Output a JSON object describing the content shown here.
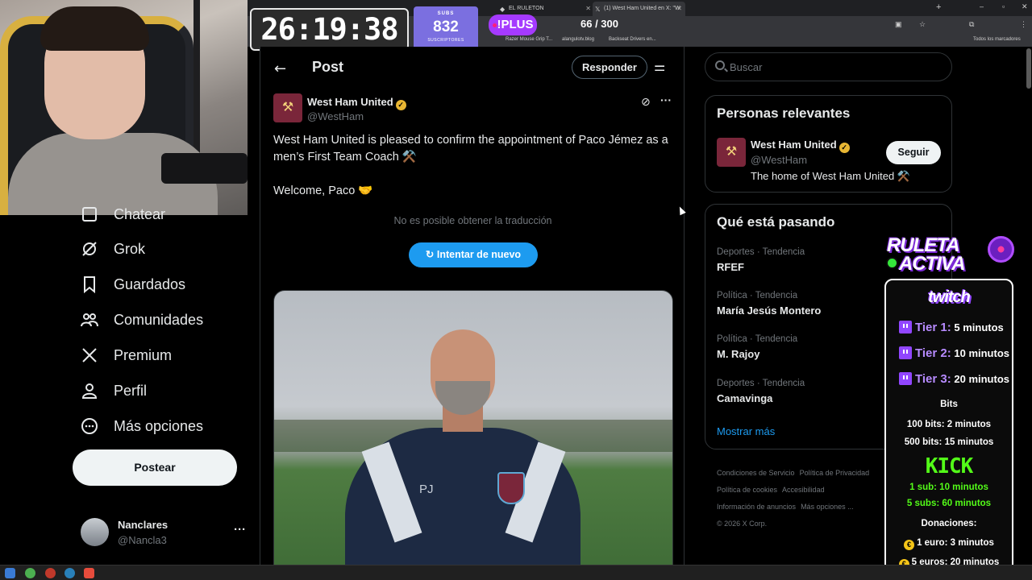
{
  "browser": {
    "tabs": [
      {
        "label": "EL RULETON",
        "active": false
      },
      {
        "label": "(1) West Ham United en X: \"W",
        "active": true
      }
    ],
    "bookmarks": [
      "Razer Mouse Grip T...",
      "alangulotv.blog",
      "Backseat Drivers en...",
      "Todos los marcadores"
    ]
  },
  "stream": {
    "timer": "26:19:38",
    "subs_label": "SUBS",
    "subs_count": "832",
    "subs_footer": "SUSCRIPTORES",
    "plus_label": "!PLUS",
    "counter": "66 / 300"
  },
  "leftnav": {
    "items": [
      {
        "label": "Chatear",
        "icon": "chat-icon"
      },
      {
        "label": "Grok",
        "icon": "grok-icon"
      },
      {
        "label": "Guardados",
        "icon": "bookmark-icon"
      },
      {
        "label": "Comunidades",
        "icon": "communities-icon"
      },
      {
        "label": "Premium",
        "icon": "x-logo-icon"
      },
      {
        "label": "Perfil",
        "icon": "profile-icon"
      },
      {
        "label": "Más opciones",
        "icon": "more-options-icon"
      }
    ],
    "post_button": "Postear",
    "user": {
      "name": "Nanclares",
      "handle": "@Nancla3"
    }
  },
  "main": {
    "title": "Post",
    "reply_button": "Responder",
    "author": {
      "name": "West Ham United",
      "handle": "@WestHam"
    },
    "text_line1": "West Ham United is pleased to confirm the appointment of Paco Jémez as a men’s First Team Coach ⚒️",
    "text_line2": "Welcome, Paco 🤝",
    "no_translation": "No es posible obtener la traducción",
    "retry_button": "Intentar de nuevo",
    "photo_initials": "PJ"
  },
  "right": {
    "search_placeholder": "Buscar",
    "relevant_title": "Personas relevantes",
    "relevant": {
      "name": "West Ham United",
      "handle": "@WestHam",
      "bio": "The home of West Ham United ⚒️",
      "follow": "Seguir"
    },
    "trends_title": "Qué está pasando",
    "trends": [
      {
        "category": "Deportes · Tendencia",
        "name": "RFEF"
      },
      {
        "category": "Política · Tendencia",
        "name": "María Jesús Montero"
      },
      {
        "category": "Política · Tendencia",
        "name": "M. Rajoy"
      },
      {
        "category": "Deportes · Tendencia",
        "name": "Camavinga"
      }
    ],
    "show_more": "Mostrar más",
    "footer": [
      "Condiciones de Servicio",
      "Política de Privacidad",
      "Política de cookies",
      "Accesibilidad",
      "Información de anuncios",
      "Más opciones ...",
      "© 2026 X Corp."
    ]
  },
  "ruleta": {
    "title1": "RULETA",
    "title2": "ACTIVA",
    "twitch": "twitch",
    "tiers": [
      {
        "key": "Tier 1:",
        "value": "5 minutos"
      },
      {
        "key": "Tier 2:",
        "value": "10 minutos"
      },
      {
        "key": "Tier 3:",
        "value": "20 minutos"
      }
    ],
    "bits_title": "Bits",
    "bits": [
      "100 bits: 2 minutos",
      "500 bits: 15 minutos"
    ],
    "kick": "KICK",
    "kick_lines": [
      "1 sub: 10 minutos",
      "5 subs: 60 minutos"
    ],
    "donations_title": "Donaciones:",
    "donations": [
      "1 euro: 3 minutos",
      "5 euros: 20 minutos"
    ]
  },
  "colors": {
    "accent": "#1d9bf0",
    "twitch": "#9146ff",
    "kick": "#53fc18",
    "westham": "#7a263a"
  }
}
